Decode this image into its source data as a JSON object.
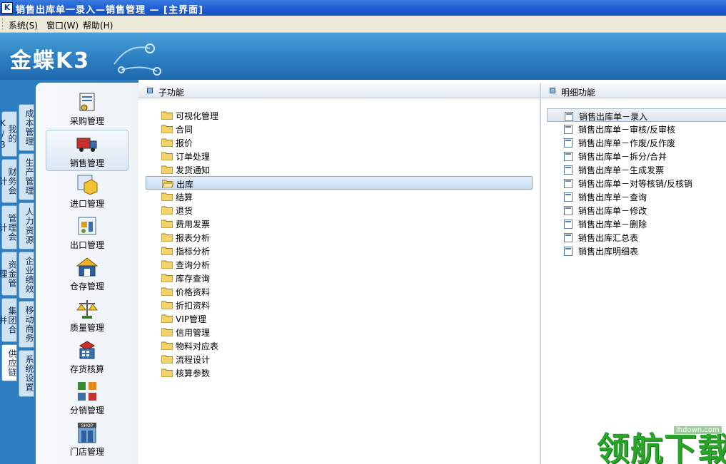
{
  "window": {
    "title": "销售出库单一录入—销售管理 — [主界面]"
  },
  "menubar": {
    "items": [
      "系统(S)",
      "窗口(W)",
      "帮助(H)"
    ]
  },
  "banner": {
    "logo": "金蝶K3"
  },
  "left_tabs": {
    "outer": [
      "我的K/3",
      "财务会计",
      "管理会计",
      "资金管理",
      "集团合并",
      "供应链"
    ],
    "inner": [
      "成本管理",
      "生产管理",
      "人力资源",
      "企业绩效",
      "移动商务",
      "系统设置"
    ],
    "active_outer": "供应链"
  },
  "modules": [
    {
      "label": "采购管理",
      "icon": "purchase-icon"
    },
    {
      "label": "销售管理",
      "icon": "sales-truck-icon"
    },
    {
      "label": "进口管理",
      "icon": "import-box-icon"
    },
    {
      "label": "出口管理",
      "icon": "export-icon"
    },
    {
      "label": "仓存管理",
      "icon": "warehouse-icon"
    },
    {
      "label": "质量管理",
      "icon": "quality-scale-icon"
    },
    {
      "label": "存货核算",
      "icon": "inventory-calc-icon"
    },
    {
      "label": "分销管理",
      "icon": "distribution-icon"
    },
    {
      "label": "门店管理",
      "icon": "shop-icon"
    }
  ],
  "selected_module": "销售管理",
  "subfunctions": {
    "header": "子功能",
    "items": [
      "可视化管理",
      "合同",
      "报价",
      "订单处理",
      "发货通知",
      "出库",
      "结算",
      "退货",
      "费用发票",
      "报表分析",
      "指标分析",
      "查询分析",
      "库存查询",
      "价格资料",
      "折扣资料",
      "VIP管理",
      "信用管理",
      "物料对应表",
      "流程设计",
      "核算参数"
    ],
    "selected": "出库"
  },
  "details": {
    "header": "明细功能",
    "items": [
      "销售出库单－录入",
      "销售出库单－审核/反审核",
      "销售出库单－作废/反作废",
      "销售出库单－拆分/合并",
      "销售出库单－生成发票",
      "销售出库单－对等核销/反核销",
      "销售出库单－查询",
      "销售出库单－修改",
      "销售出库单－删除",
      "销售出库汇总表",
      "销售出库明细表"
    ],
    "selected": "销售出库单－录入"
  },
  "watermark": {
    "text": "领航下载",
    "url": "lhdown.com"
  },
  "colors": {
    "titlebar": "#1c5bd0",
    "banner": "#2b7fc2",
    "folder": "#f2c94c",
    "watermark": "#2aa32a"
  }
}
